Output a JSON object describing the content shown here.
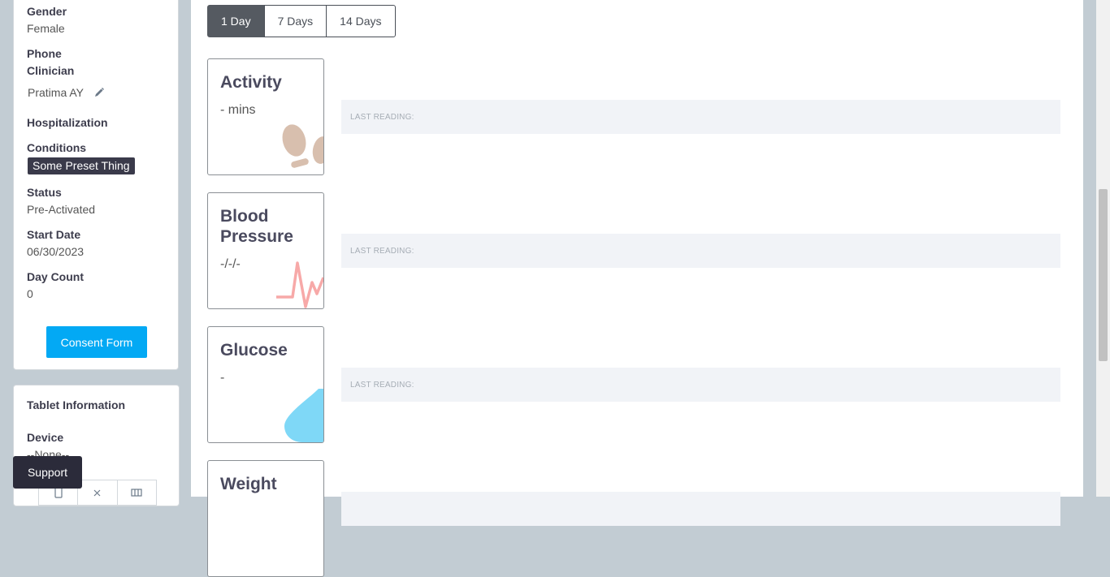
{
  "patient": {
    "gender_label": "Gender",
    "gender_value": "Female",
    "phone_label": "Phone",
    "clinician_label": "Clinician",
    "clinician_value": "Pratima AY",
    "hospitalization_label": "Hospitalization",
    "conditions_label": "Conditions",
    "condition_badge": "Some Preset Thing",
    "status_label": "Status",
    "status_value": "Pre-Activated",
    "start_date_label": "Start Date",
    "start_date_value": "06/30/2023",
    "day_count_label": "Day Count",
    "day_count_value": "0",
    "consent_button": "Consent Form"
  },
  "tablet": {
    "title": "Tablet Information",
    "device_label": "Device",
    "device_value": "--None--"
  },
  "support_button": "Support",
  "range_tabs": [
    "1 Day",
    "7 Days",
    "14 Days"
  ],
  "active_tab": "1 Day",
  "metrics": [
    {
      "title": "Activity",
      "value": "- mins",
      "last_reading": "LAST READING:",
      "icon": "footprints-icon"
    },
    {
      "title": "Blood Pressure",
      "value": "-/-/-",
      "last_reading": "LAST READING:",
      "icon": "heartbeat-icon"
    },
    {
      "title": "Glucose",
      "value": "-",
      "last_reading": "LAST READING:",
      "icon": "droplet-icon"
    },
    {
      "title": "Weight",
      "value": "",
      "last_reading": "",
      "icon": ""
    }
  ],
  "colors": {
    "primary": "#03a9f4",
    "active_tab": "#555a61",
    "badge": "#3a3a4a",
    "activity_icon": "#d8bfae",
    "bp_icon": "#f7a9a8",
    "glucose_icon": "#7fd8f7"
  }
}
